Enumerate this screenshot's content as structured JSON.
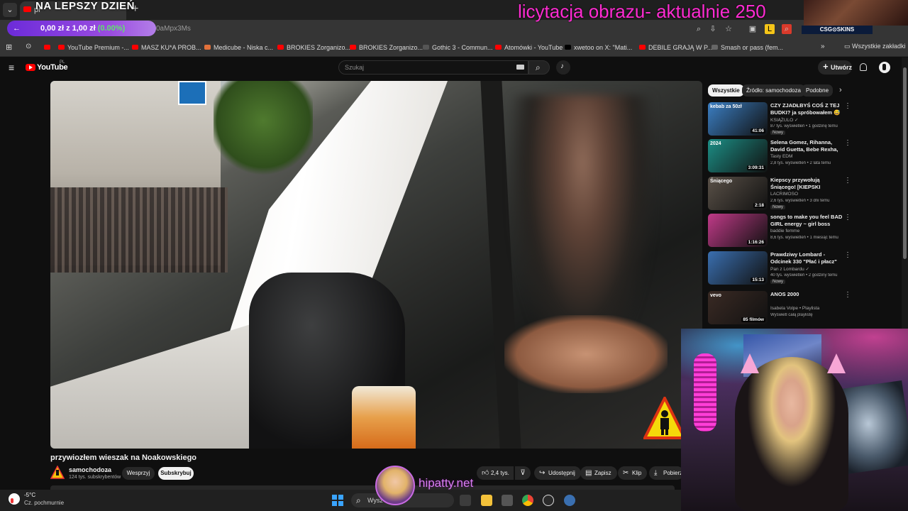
{
  "browser": {
    "tab_title": "pr",
    "url_fragment": "0aMpx3Ms",
    "bookmarks": [
      {
        "label": "YouTube Premium -...",
        "color": "#ff0000"
      },
      {
        "label": "MASZ KU*A PROB...",
        "color": "#ff0000"
      },
      {
        "label": "Medicube - Niska c...",
        "color": "#e2713b"
      },
      {
        "label": "BROKIES Zorganizo...",
        "color": "#ff0000"
      },
      {
        "label": "BROKIES Zorganizo...",
        "color": "#ff0000"
      },
      {
        "label": "Gothic 3 - Commun...",
        "color": "#555555"
      },
      {
        "label": "Atomówki - YouTube",
        "color": "#ff0000"
      },
      {
        "label": "xwetoo on X: \"Mati...",
        "color": "#000000"
      },
      {
        "label": "DEBILE GRAJĄ W P...",
        "color": "#ff0000"
      },
      {
        "label": "Smash or pass (fem...",
        "color": "#666666"
      }
    ],
    "all_bookmarks": "Wszystkie zakładki"
  },
  "overlay": {
    "banner": "NA LEPSZY DZIEŃ",
    "donation_amount": "0,00 zł z 1,00 zł",
    "donation_percent": "(0.00%)",
    "auction_text": "licytacja obrazu-  aktualnie 250",
    "sponsor": "CSG⊙SKINS",
    "streamer_site": "hipatty.net"
  },
  "youtube": {
    "logo": "YouTube",
    "country": "PL",
    "search_placeholder": "Szukaj",
    "create_label": "Utwórz",
    "video": {
      "title": "przywiozłem wieszak na Noakowskiego",
      "channel": "samochodoza",
      "subscribers": "124 tys. subskrybentów",
      "join_label": "Wesprzyj",
      "subscribe_label": "Subskrybuj",
      "likes": "2,4 tys.",
      "share": "Udostępnij",
      "save": "Zapisz",
      "clip": "Klip",
      "download": "Pobierz"
    },
    "chips": [
      "Wszystkie",
      "Źródło: samochodoza",
      "Podobne"
    ],
    "recommendations": [
      {
        "title": "CZY ZJADŁBYŚ COŚ Z TEJ BUDKI? ja spróbowałem 😅",
        "channel": "KSIĄŻULO ✓",
        "meta": "87 tys. wyświetleń • 1 godzinę temu",
        "badge": "Nowy",
        "duration": "41:06",
        "thumb_color": "#3b7fc4",
        "thumb_text": "kebab za 50zł"
      },
      {
        "title": "Selena Gomez, Rihanna, David Guetta, Bebe Rexha, Alan ...",
        "channel": "Tasty EDM",
        "meta": "2,8 tys. wyświetleń • 2 lata temu",
        "badge": "",
        "duration": "3:09:31",
        "thumb_color": "#1c8f86",
        "thumb_text": "2024"
      },
      {
        "title": "Kiepscy przywołują Śniącego! [KIEPSKI GOTHIC]",
        "channel": "LACRIMOSO",
        "meta": "2,6 tys. wyświetleń • 3 dni temu",
        "badge": "Nowy",
        "duration": "2:18",
        "thumb_color": "#5a5148",
        "thumb_text": "Śniącego"
      },
      {
        "title": "songs to make you feel BAD GIRL energy ~ girl boss playlis...",
        "channel": "baddie femme",
        "meta": "8,6 tys. wyświetleń • 1 miesiąc temu",
        "badge": "",
        "duration": "1:16:26",
        "thumb_color": "#c03a88",
        "thumb_text": ""
      },
      {
        "title": "Prawdziwy Lombard - Odcinek 330 \"Płać i płacz\"",
        "channel": "Pan z Lombardu ✓",
        "meta": "40 tys. wyświetleń • 2 godziny temu",
        "badge": "Nowy",
        "duration": "15:13",
        "thumb_color": "#3a6fb0",
        "thumb_text": ""
      },
      {
        "title": "ANOS 2000",
        "channel": "Isabela Volpe • Playlista",
        "meta": "Wyświetl całą playlistę",
        "badge": "",
        "duration": "85 filmów",
        "thumb_color": "#3a2a24",
        "thumb_text": "vevo"
      }
    ]
  },
  "taskbar": {
    "temperature": "-5°C",
    "condition": "Cz. pochmurnie",
    "search_placeholder": "Wysz"
  },
  "colors": {
    "auction": "#ff2bd2",
    "donation_green": "#5ee86a",
    "youtube_red": "#ff0000"
  }
}
